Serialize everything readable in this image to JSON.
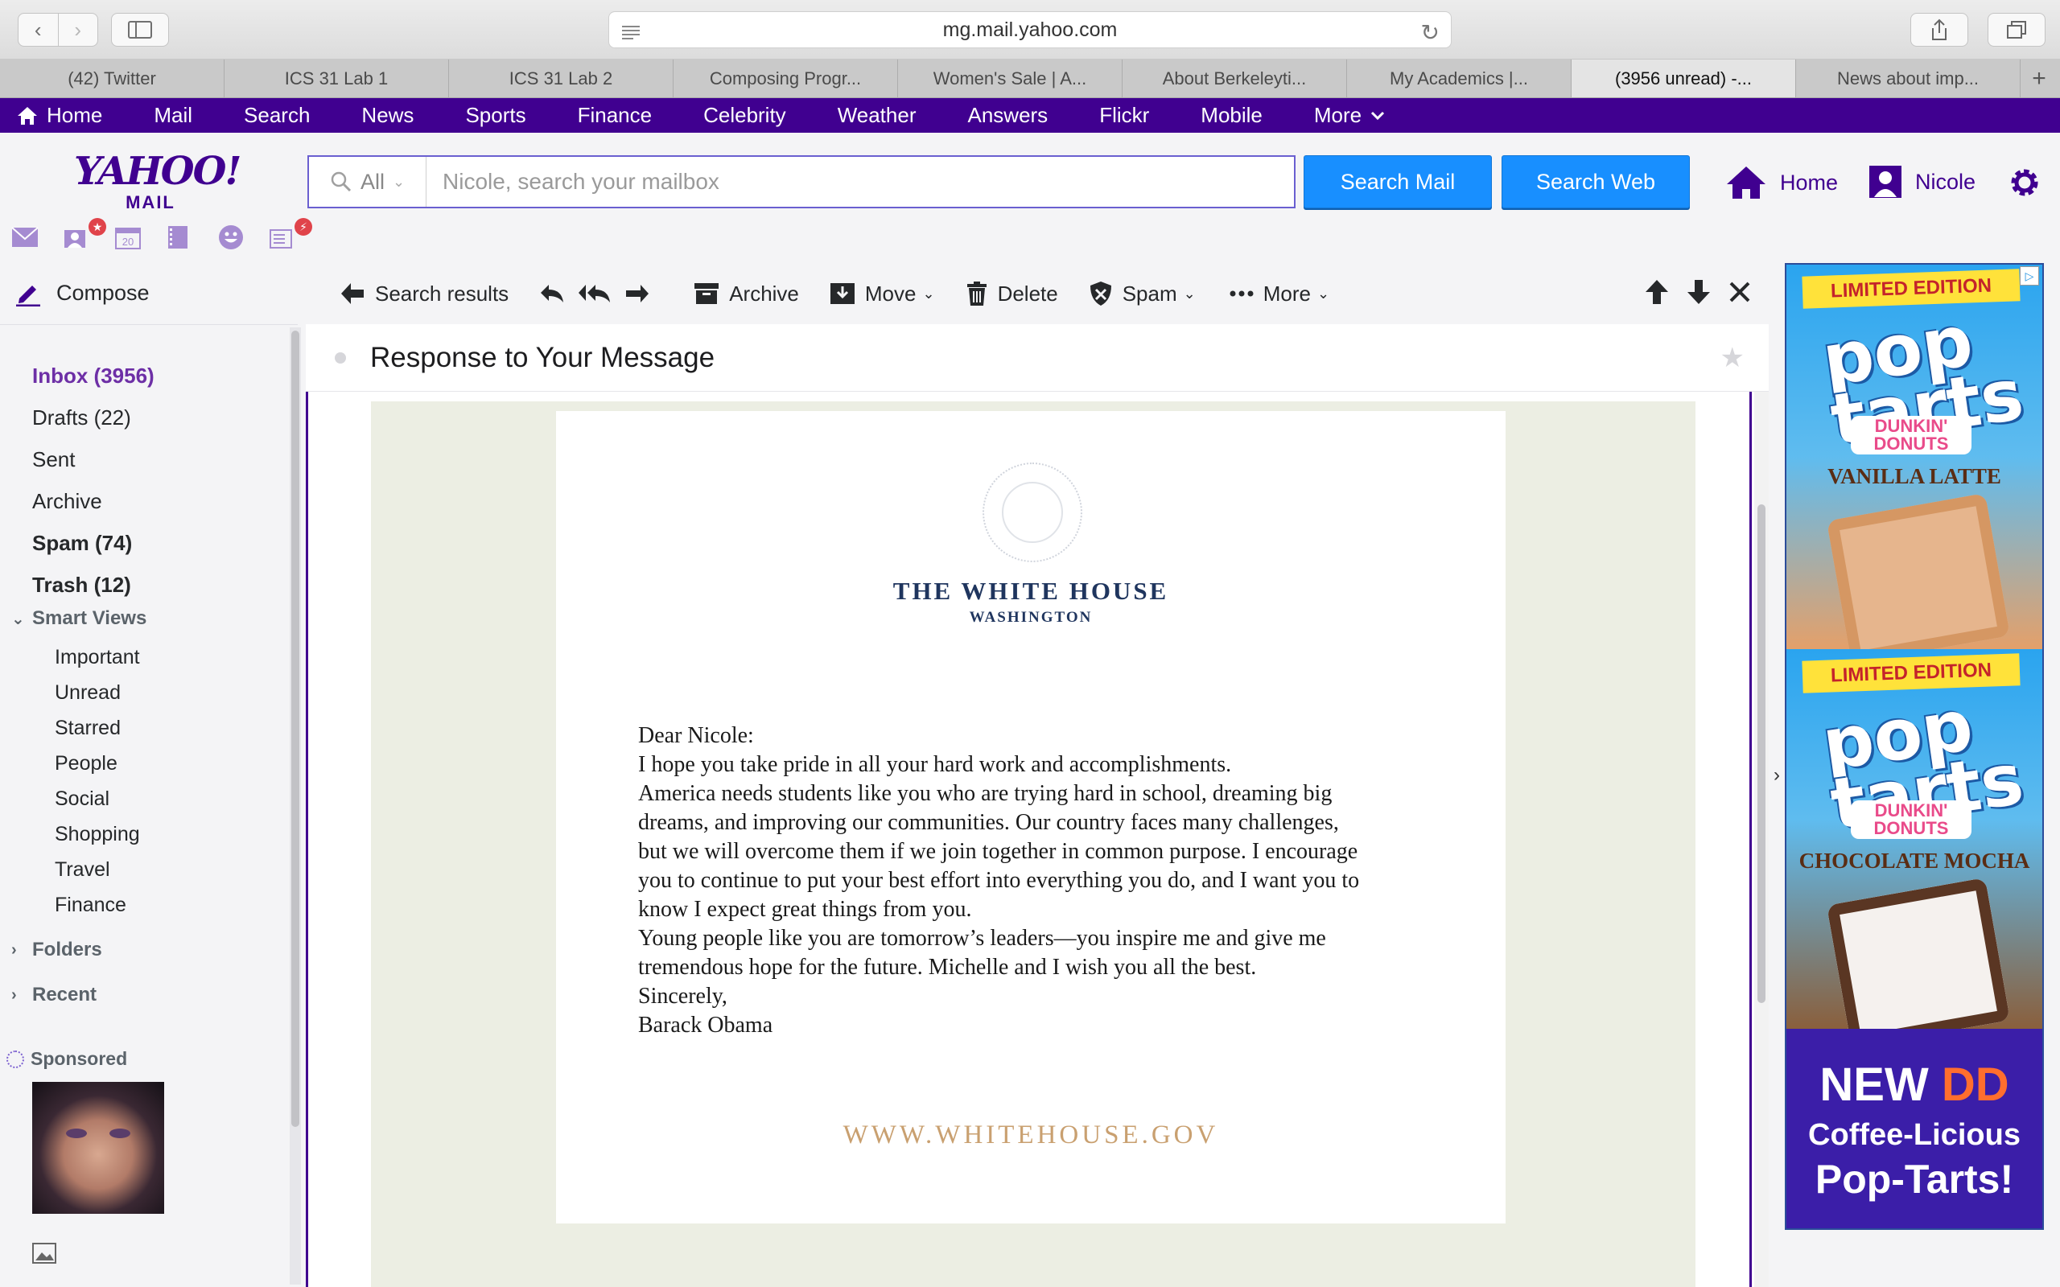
{
  "browser": {
    "url": "mg.mail.yahoo.com",
    "tabs": [
      {
        "label": "(42) Twitter"
      },
      {
        "label": "ICS 31 Lab 1"
      },
      {
        "label": "ICS 31 Lab 2"
      },
      {
        "label": "Composing Progr..."
      },
      {
        "label": "Women's Sale | A..."
      },
      {
        "label": "About Berkeleyti..."
      },
      {
        "label": "My Academics |..."
      },
      {
        "label": "(3956 unread) -..."
      },
      {
        "label": "News about imp..."
      }
    ],
    "active_tab_index": 7,
    "new_tab_symbol": "+"
  },
  "yahoo_nav": {
    "items": [
      {
        "label": "Home",
        "icon": "home-icon"
      },
      {
        "label": "Mail"
      },
      {
        "label": "Search"
      },
      {
        "label": "News"
      },
      {
        "label": "Sports"
      },
      {
        "label": "Finance"
      },
      {
        "label": "Celebrity"
      },
      {
        "label": "Weather"
      },
      {
        "label": "Answers"
      },
      {
        "label": "Flickr"
      },
      {
        "label": "Mobile"
      },
      {
        "label": "More"
      }
    ]
  },
  "header": {
    "logo_main": "YAHOO!",
    "logo_sub": "MAIL",
    "search_scope": "All",
    "search_placeholder": "Nicole, search your mailbox",
    "search_mail_label": "Search Mail",
    "search_web_label": "Search Web",
    "home_label": "Home",
    "user_label": "Nicole",
    "calendar_day": "20"
  },
  "sidebar": {
    "compose_label": "Compose",
    "folders": [
      {
        "label": "Inbox (3956)"
      },
      {
        "label": "Drafts (22)"
      },
      {
        "label": "Sent"
      },
      {
        "label": "Archive"
      },
      {
        "label": "Spam (74)"
      },
      {
        "label": "Trash (12)"
      }
    ],
    "smart_views_label": "Smart Views",
    "smart_views": [
      {
        "label": "Important"
      },
      {
        "label": "Unread"
      },
      {
        "label": "Starred"
      },
      {
        "label": "People"
      },
      {
        "label": "Social"
      },
      {
        "label": "Shopping"
      },
      {
        "label": "Travel"
      },
      {
        "label": "Finance"
      }
    ],
    "folders_label": "Folders",
    "recent_label": "Recent",
    "sponsored_label": "Sponsored"
  },
  "toolbar": {
    "back_label": "Search results",
    "archive_label": "Archive",
    "move_label": "Move",
    "delete_label": "Delete",
    "spam_label": "Spam",
    "more_label": "More"
  },
  "message": {
    "subject": "Response to Your Message",
    "letterhead_title": "THE WHITE HOUSE",
    "letterhead_sub": "WASHINGTON",
    "body": [
      "Dear Nicole:",
      "I hope you take pride in all your hard work and accomplishments.",
      "America needs students like you who are trying hard in school, dreaming big",
      "dreams, and improving our communities.  Our country faces many challenges,",
      "but we will overcome them if we join together in common purpose.  I encourage",
      "you to continue to put your best effort into everything you do, and I want you to",
      "know I expect great things from you.",
      "Young people like you are tomorrow’s leaders—you inspire me and give me",
      "tremendous hope for the future.  Michelle and I wish you all the best.",
      "Sincerely,",
      "Barack Obama"
    ],
    "footer_url": "WWW.WHITEHOUSE.GOV"
  },
  "ad": {
    "banner_1": "LIMITED EDITION",
    "brand_line_1": "pop",
    "brand_line_2": "tarts",
    "partner_line_1": "DUNKIN'",
    "partner_line_2": "DONUTS",
    "flavor_1": "VANILLA LATTE",
    "banner_2": "LIMITED EDITION",
    "flavor_2": "CHOCOLATE MOCHA",
    "new_word": "NEW",
    "dd_mark": "DD",
    "tagline_1": "Coffee-Licious",
    "tagline_2": "Pop-Tarts!",
    "colors": {
      "yahoo_purple": "#400090",
      "search_blue": "#188fff"
    }
  }
}
